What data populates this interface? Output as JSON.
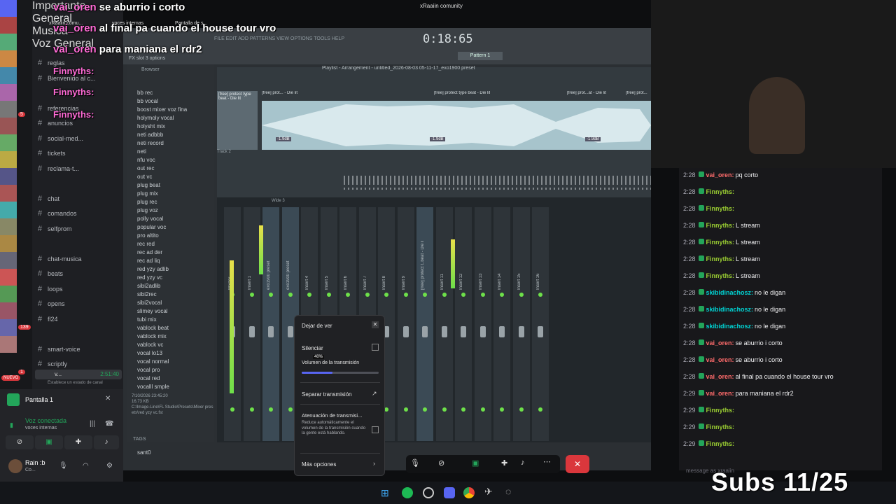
{
  "overlay": {
    "top_chat": [
      {
        "user": "vai_oren",
        "text": "se aburrio i corto"
      },
      {
        "user": "vai_oren",
        "text": "al final pa cuando el house tour vro"
      },
      {
        "user": "vai_oren",
        "text": "para maniana el rdr2"
      },
      {
        "user": "Finnyths:",
        "text": ""
      },
      {
        "user": "Finnyths:",
        "text": ""
      },
      {
        "user": "Finnyths:",
        "text": ""
      }
    ],
    "window_title": "xRaaiin comunity",
    "subs": "Subs 11/25"
  },
  "discord": {
    "server_badges": [
      "5",
      "139",
      "1"
    ],
    "tabs": [
      "xRaaiin comu...",
      "voces internas",
      "Pantalla de s..."
    ],
    "channels": [
      {
        "name": "reglas",
        "icon": "hash"
      },
      {
        "name": "Bienvenido al c...",
        "icon": "hash"
      },
      {
        "name": "Importante",
        "icon": "category"
      },
      {
        "name": "referencias",
        "icon": "hash"
      },
      {
        "name": "anuncios",
        "icon": "hash"
      },
      {
        "name": "social-med...",
        "icon": "hash"
      },
      {
        "name": "tickets",
        "icon": "hash"
      },
      {
        "name": "reclama-t...",
        "icon": "hash"
      },
      {
        "name": "General",
        "icon": "category"
      },
      {
        "name": "chat",
        "icon": "hash"
      },
      {
        "name": "comandos",
        "icon": "hash"
      },
      {
        "name": "selfprom",
        "icon": "hash"
      },
      {
        "name": "Musica",
        "icon": "category"
      },
      {
        "name": "chat-musica",
        "icon": "hash"
      },
      {
        "name": "beats",
        "icon": "hash"
      },
      {
        "name": "loops",
        "icon": "hash"
      },
      {
        "name": "opens",
        "icon": "hash"
      },
      {
        "name": "fl24",
        "icon": "hash"
      },
      {
        "name": "Voz General",
        "icon": "category"
      },
      {
        "name": "smart-voice",
        "icon": "hash"
      },
      {
        "name": "scriptly",
        "icon": "hash"
      }
    ],
    "active_voice": {
      "name": "v...",
      "time": "2:51:40",
      "status_hint": "Establece un estado de canal"
    },
    "nuevo_badge": "NUEVO",
    "screen_share": "Pantalla 1",
    "voice_connected": "Voz conectada",
    "voice_channel": "voces internas",
    "user": {
      "name": "Rain :b",
      "status": "Co..."
    }
  },
  "fl": {
    "timer": "0:18:65",
    "menu": "FILE EDIT ADD PATTERNS VIEW OPTIONS TOOLS HELP",
    "hint": "FX slot 3 options",
    "pattern": "Pattern 1",
    "playlist_title": "Playlist - Arrangement - untitled_2026-08-03 05-11-17_exo1900 preset",
    "browser_title": "Browser",
    "browser_items": [
      "bb rec",
      "bb vocal",
      "boost mixer voz fina",
      "holymoly vocal",
      "holysht mix",
      "neti adbbb",
      "neti record",
      "neti",
      "nfu voc",
      "out rec",
      "out vc",
      "plug beat",
      "plug mix",
      "plug rec",
      "plug voz",
      "polly vocal",
      "popular voc",
      "pro altito",
      "rec red",
      "rec ad der",
      "rec ad liq",
      "red yzy adlib",
      "red yzy vc",
      "sibi2adlib",
      "sibi2rec",
      "sibi2vocal",
      "slimey vocal",
      "tubi mix",
      "vablock beat",
      "vablock mix",
      "vablock vc",
      "vocal lo13",
      "vocal normal",
      "vocal pro",
      "vocal red",
      "vocalll smple"
    ],
    "track1_label": "[free] protect type beat - Die lit",
    "track2_label": "Track 2",
    "clip_labels": [
      "[free] prot... - Die lit",
      "[free] protect type beat - Die lit",
      "[free] prot...at - Die lit",
      "[free] prot..."
    ],
    "clip_db": [
      "-1.9dB",
      "-1.9dB",
      "-1.9dB"
    ],
    "mixer_title": "Wide 3",
    "mixer_channels": [
      "Master",
      "Insert 1",
      "exo1900 preset",
      "exo1900 preset",
      "Insert 4",
      "Insert 5",
      "Insert 6",
      "Insert 7",
      "Insert 8",
      "Insert 9",
      "[free] protect t..beat - Die lit",
      "Insert 11",
      "Insert 12",
      "Insert 13",
      "Insert 14",
      "Insert 15",
      "Insert 16"
    ],
    "file_info": {
      "date": "7/10/2026 23:45:20",
      "size": "16.73 KB",
      "path": "C:\\Image-Line\\FL Studio\\Presets\\Mixer presets\\red yzy vc.fst"
    },
    "tags": "TAGS",
    "sample_name": "sant0"
  },
  "popup": {
    "title": "Dejar de ver",
    "mute": "Silenciar",
    "volume_label": "Volumen de la transmisión",
    "volume_pct": "40%",
    "volume_value": 0.4,
    "separate": "Separar transmisión",
    "attenuation_title": "Atenuación de transmisi...",
    "attenuation_desc": "Reduce automáticamente el volumen de la transmisión cuando la gente está hablando.",
    "more": "Más opciones"
  },
  "chat": [
    {
      "time": "2:28",
      "user": "vai_oren:",
      "text": "pq corto",
      "color": "#ff6b6b"
    },
    {
      "time": "2:28",
      "user": "Finnyths:",
      "text": "",
      "color": "#9acd32"
    },
    {
      "time": "2:28",
      "user": "Finnyths:",
      "text": "",
      "color": "#9acd32"
    },
    {
      "time": "2:28",
      "user": "Finnyths:",
      "text": "L stream",
      "color": "#9acd32"
    },
    {
      "time": "2:28",
      "user": "Finnyths:",
      "text": "L stream",
      "color": "#9acd32"
    },
    {
      "time": "2:28",
      "user": "Finnyths:",
      "text": "L stream",
      "color": "#9acd32"
    },
    {
      "time": "2:28",
      "user": "Finnyths:",
      "text": "L stream",
      "color": "#9acd32"
    },
    {
      "time": "2:28",
      "user": "skibidinachosz:",
      "text": "no le digan",
      "color": "#00d4d4"
    },
    {
      "time": "2:28",
      "user": "skibidinachosz:",
      "text": "no le digan",
      "color": "#00d4d4"
    },
    {
      "time": "2:28",
      "user": "skibidinachosz:",
      "text": "no le digan",
      "color": "#00d4d4"
    },
    {
      "time": "2:28",
      "user": "vai_oren:",
      "text": "se aburrio i corto",
      "color": "#ff6b6b"
    },
    {
      "time": "2:28",
      "user": "vai_oren:",
      "text": "se aburrio i corto",
      "color": "#ff6b6b"
    },
    {
      "time": "2:28",
      "user": "vai_oren:",
      "text": "al final pa cuando el house tour vro",
      "color": "#ff6b6b"
    },
    {
      "time": "2:29",
      "user": "vai_oren:",
      "text": "para maniana el rdr2",
      "color": "#ff6b6b"
    },
    {
      "time": "2:29",
      "user": "Finnyths:",
      "text": "",
      "color": "#9acd32"
    },
    {
      "time": "2:29",
      "user": "Finnyths:",
      "text": "",
      "color": "#9acd32"
    },
    {
      "time": "2:29",
      "user": "Finnyths:",
      "text": "",
      "color": "#9acd32"
    }
  ],
  "chat_input_placeholder": "message as xraaiin",
  "colors": {
    "accent": "#5865f2",
    "green": "#23a55a",
    "red": "#da373c",
    "fl_green": "#6ee04a"
  }
}
